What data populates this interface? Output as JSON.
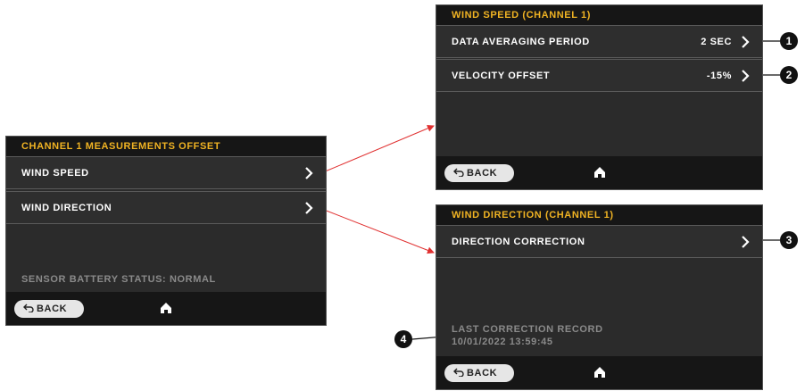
{
  "screens": {
    "main": {
      "title": "CHANNEL 1 MEASUREMENTS OFFSET",
      "items": [
        {
          "label": "WIND SPEED"
        },
        {
          "label": "WIND DIRECTION"
        }
      ],
      "status": "SENSOR BATTERY STATUS: NORMAL",
      "back_label": "BACK"
    },
    "wind_speed": {
      "title": "WIND SPEED (CHANNEL 1)",
      "items": [
        {
          "label": "DATA AVERAGING PERIOD",
          "value": "2 SEC"
        },
        {
          "label": "VELOCITY OFFSET",
          "value": "-15%"
        }
      ],
      "back_label": "BACK"
    },
    "wind_direction": {
      "title": "WIND DIRECTION (CHANNEL 1)",
      "items": [
        {
          "label": "DIRECTION CORRECTION"
        }
      ],
      "record_label": "LAST CORRECTION RECORD",
      "record_value": "10/01/2022 13:59:45",
      "back_label": "BACK"
    }
  },
  "callouts": [
    "1",
    "2",
    "3",
    "4"
  ],
  "colors": {
    "accent": "#f0b323",
    "screen_bg": "#2b2b2b",
    "bar_bg": "#161616",
    "arrow": "#e03030",
    "status_text": "#8a8a8a"
  },
  "icons": [
    "chevron-right-icon",
    "back-arrow-icon",
    "home-icon"
  ]
}
